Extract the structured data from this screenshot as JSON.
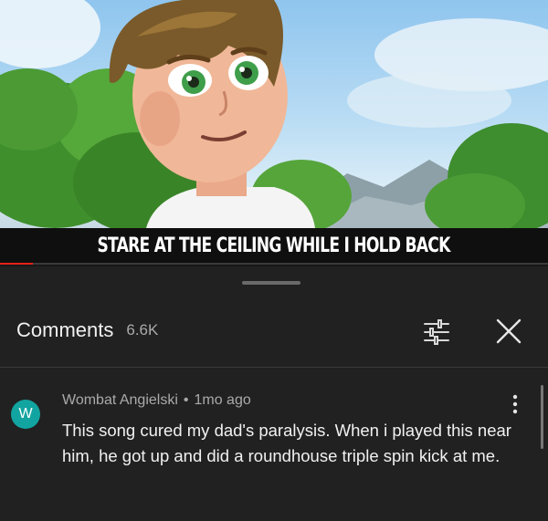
{
  "video": {
    "caption": "STARE AT THE CEILING WHILE I HOLD BACK",
    "progress": 0.06
  },
  "comments_panel": {
    "title": "Comments",
    "count": "6.6K",
    "filter_icon": "sliders-icon",
    "close_icon": "close-icon"
  },
  "comments": [
    {
      "avatar_letter": "W",
      "avatar_color": "#12a4a0",
      "author": "Wombat Angielski",
      "separator": "•",
      "time": "1mo ago",
      "text": "This song cured my dad's paralysis. When i played this near him, he got up and did a roundhouse triple spin kick at me."
    }
  ],
  "colors": {
    "sheet_background": "#212121",
    "progress_red": "#e62117"
  }
}
